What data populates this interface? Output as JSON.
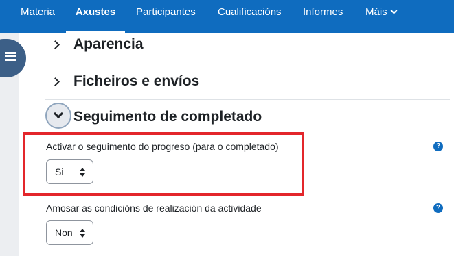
{
  "nav": {
    "tabs": [
      {
        "label": "Materia"
      },
      {
        "label": "Axustes"
      },
      {
        "label": "Participantes"
      },
      {
        "label": "Cualificacións"
      },
      {
        "label": "Informes"
      },
      {
        "label": "Máis"
      }
    ],
    "active_tab": "Axustes"
  },
  "sections": {
    "aparencia": {
      "title": "Aparencia",
      "expanded": false
    },
    "ficheiros": {
      "title": "Ficheiros e envíos",
      "expanded": false
    },
    "seguimento": {
      "title": "Seguimento de completado",
      "expanded": true
    }
  },
  "form": {
    "progress_tracking": {
      "label": "Activar o seguimento do progreso (para o completado)",
      "value": "Si",
      "help": "?"
    },
    "show_conditions": {
      "label": "Amosar as condicións de realización da actividade",
      "value": "Non",
      "help": "?"
    }
  },
  "colors": {
    "navbar": "#0f6cbf",
    "highlight": "#e3262b",
    "drawer_toggle": "#3c5f87",
    "help_icon": "#0f6cbf"
  },
  "icons": {
    "drawer_toggle": "list-icon",
    "more_menu": "chevron-down-icon",
    "section_collapsed": "chevron-right-icon",
    "section_expanded": "chevron-down-icon",
    "help": "question-circle-icon"
  }
}
